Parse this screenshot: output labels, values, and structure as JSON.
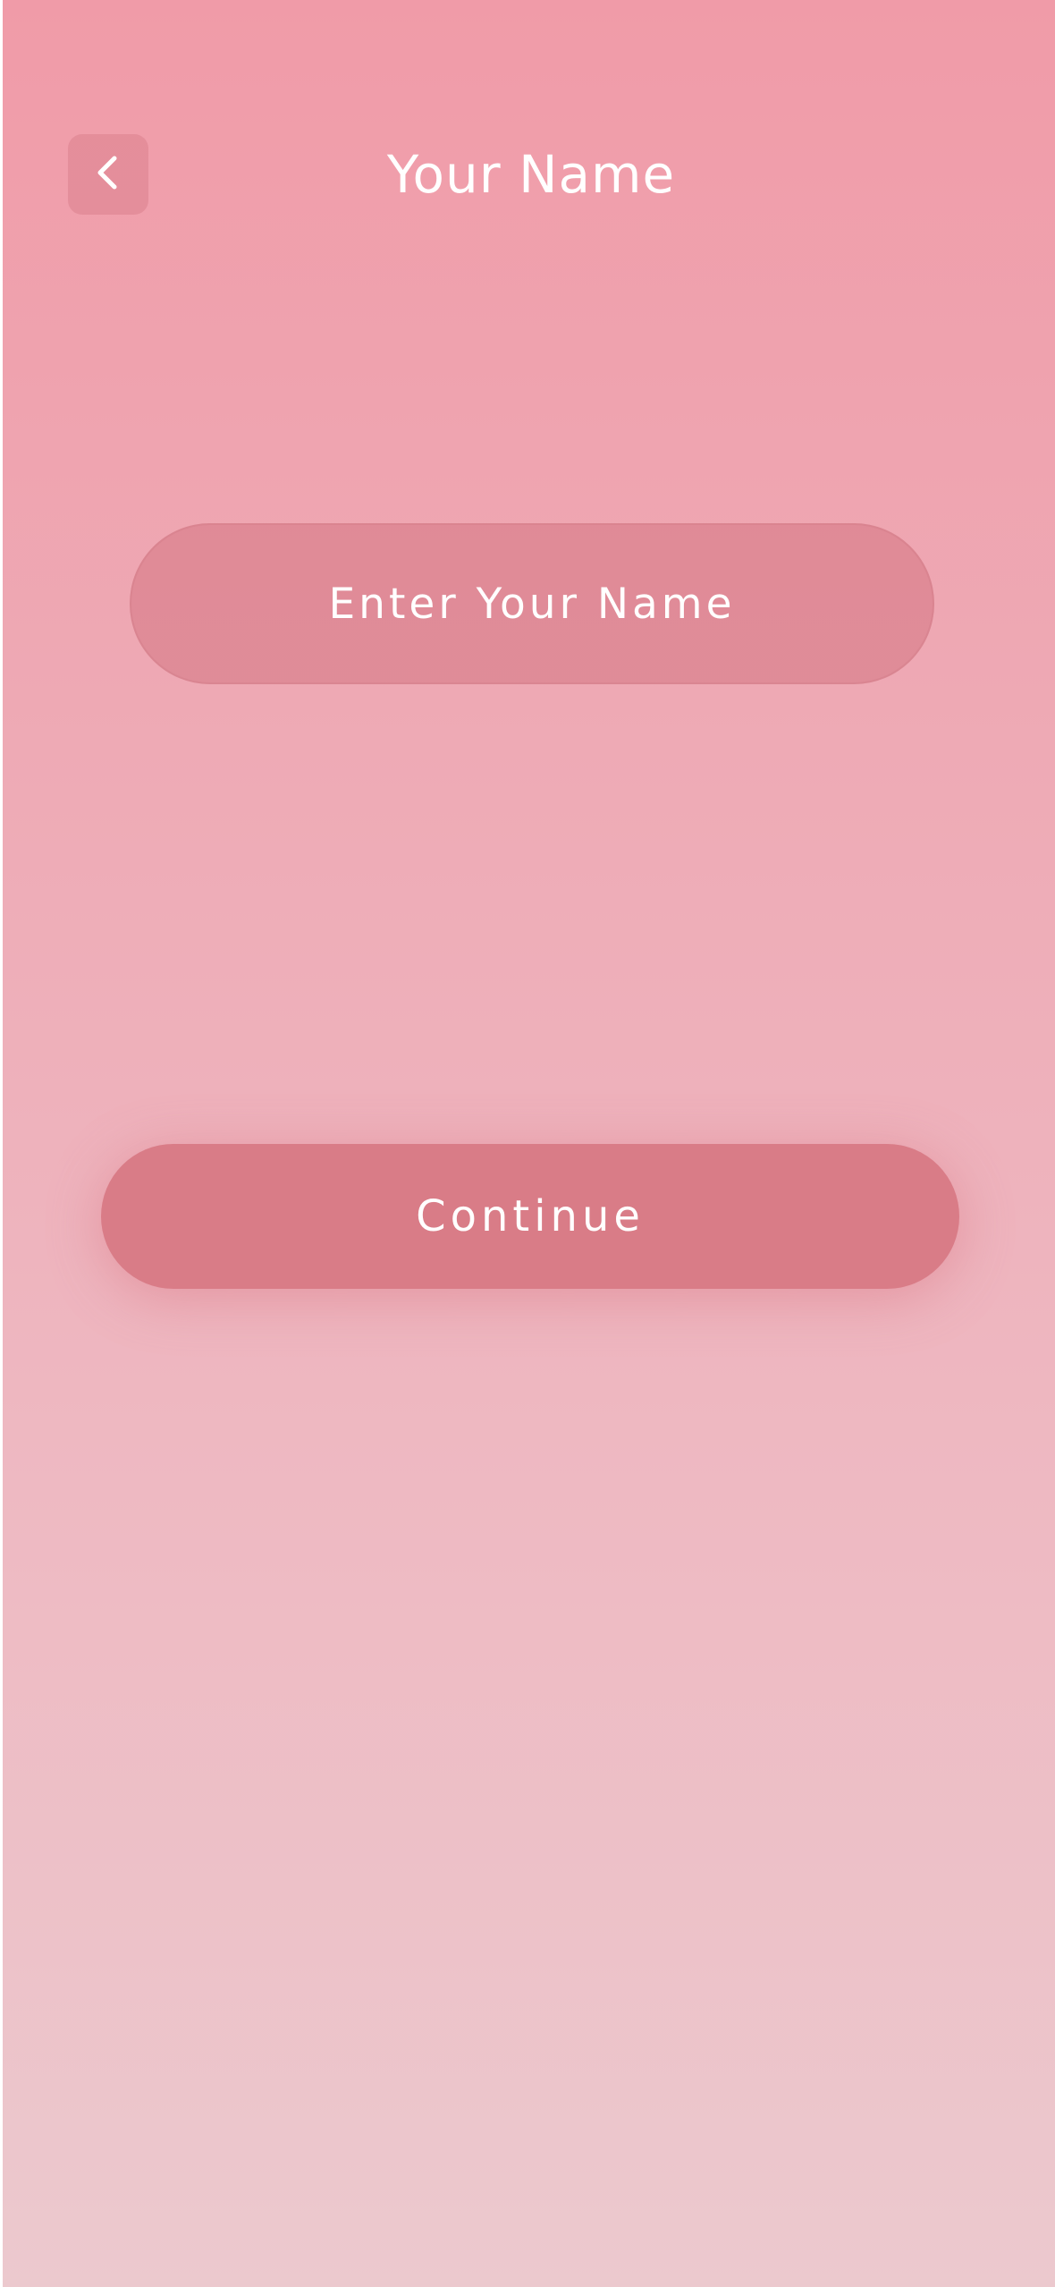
{
  "header": {
    "title": "Your Name",
    "back_icon": "chevron-left-icon"
  },
  "form": {
    "name_placeholder": "Enter Your Name",
    "name_value": ""
  },
  "actions": {
    "continue_label": "Continue"
  },
  "colors": {
    "background_top": "#f09ba8",
    "background_bottom": "#ecc9ce",
    "button": "#d97c87",
    "text": "#ffffff"
  }
}
